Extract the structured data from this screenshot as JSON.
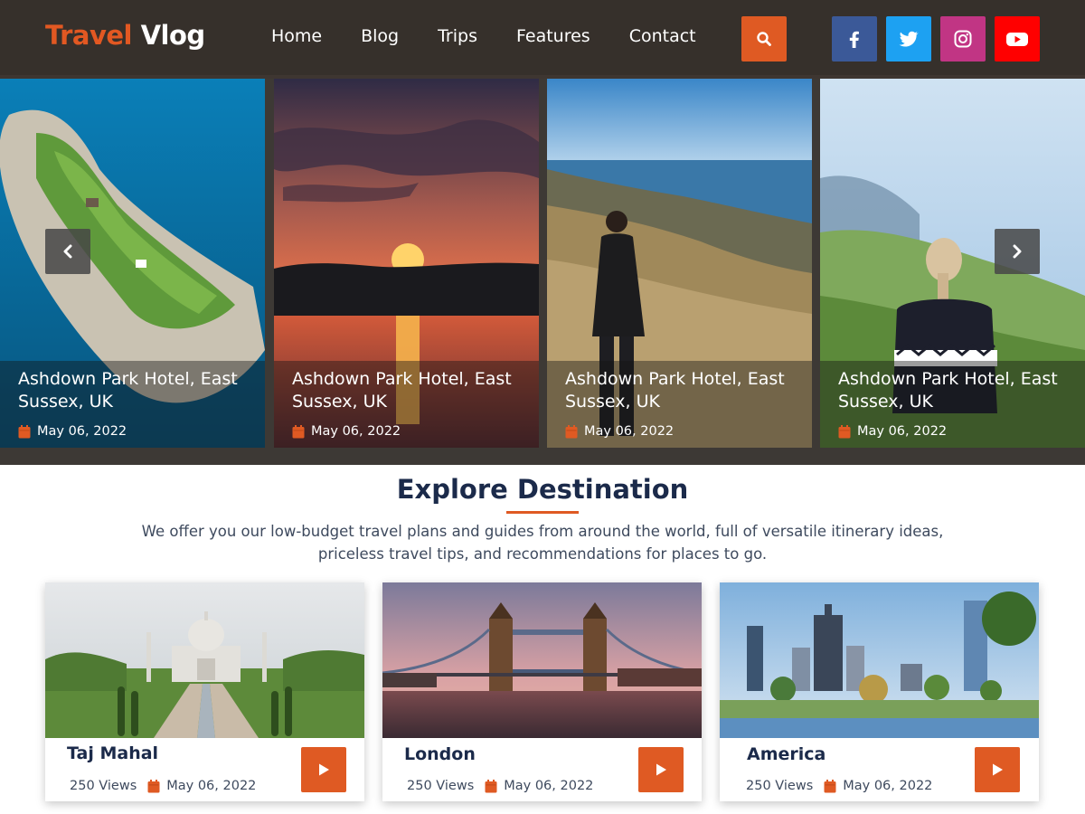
{
  "header": {
    "logo_part1": "Travel",
    "logo_part2": "Vlog",
    "nav": [
      "Home",
      "Blog",
      "Trips",
      "Features",
      "Contact"
    ],
    "search_icon": "search-icon",
    "social": [
      {
        "name": "facebook-icon",
        "color": "#3b5998"
      },
      {
        "name": "twitter-icon",
        "color": "#1da1f2"
      },
      {
        "name": "instagram-icon",
        "color": "#c13584"
      },
      {
        "name": "youtube-icon",
        "color": "#ff0000"
      }
    ]
  },
  "hero": {
    "slides": [
      {
        "title": "Ashdown Park Hotel, East Sussex, UK",
        "date": "May 06, 2022"
      },
      {
        "title": "Ashdown Park Hotel, East Sussex, UK",
        "date": "May 06, 2022"
      },
      {
        "title": "Ashdown Park Hotel, East Sussex, UK",
        "date": "May 06, 2022"
      },
      {
        "title": "Ashdown Park Hotel, East Sussex, UK",
        "date": "May 06, 2022"
      }
    ],
    "prev_icon": "chevron-left-icon",
    "next_icon": "chevron-right-icon"
  },
  "explore": {
    "title": "Explore Destination",
    "description": "We offer you our low-budget travel plans and guides from around the world, full of versatile itinerary ideas, priceless travel tips, and recommendations for places to go.",
    "cards": [
      {
        "title": "Taj Mahal",
        "views": "250 Views",
        "date": "May 06, 2022"
      },
      {
        "title": "London",
        "views": "250 Views",
        "date": "May 06, 2022"
      },
      {
        "title": "America",
        "views": "250 Views",
        "date": "May 06, 2022"
      }
    ]
  },
  "colors": {
    "accent": "#df5a23",
    "header_bg": "#36302b",
    "heading": "#1b2a4a"
  }
}
